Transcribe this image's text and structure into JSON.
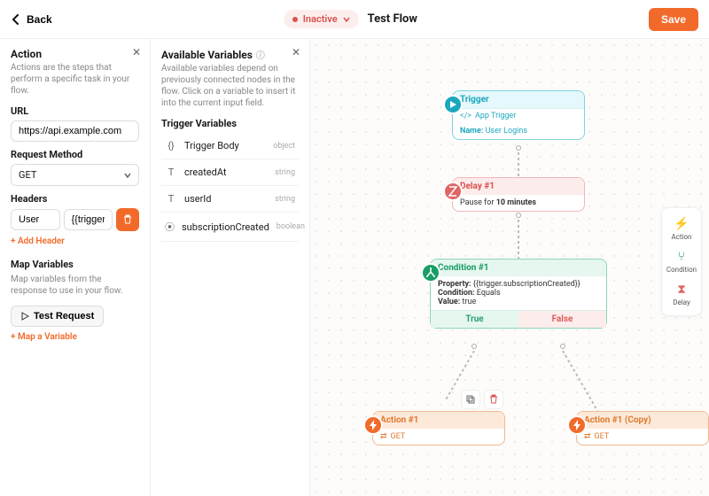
{
  "header": {
    "back_label": "Back",
    "status_label": "Inactive",
    "flow_title": "Test Flow",
    "save_label": "Save"
  },
  "action_panel": {
    "title": "Action",
    "subtitle": "Actions are the steps that perform a specific task in your flow.",
    "url_label": "URL",
    "url_value": "https://api.example.com",
    "method_label": "Request Method",
    "method_value": "GET",
    "headers_label": "Headers",
    "header_key": "User",
    "header_value": "{{trigger.userId}}",
    "add_header": "+ Add Header",
    "map_title": "Map Variables",
    "map_subtitle": "Map variables from the response to use in your flow.",
    "test_request": "Test Request",
    "map_variable": "+ Map a Variable"
  },
  "variables_panel": {
    "title": "Available Variables",
    "subtitle": "Available variables depend on previously connected nodes in the flow. Click on a variable to insert it into the current input field.",
    "group_label": "Trigger Variables",
    "items": [
      {
        "icon": "{}",
        "name": "Trigger Body",
        "kind": "object"
      },
      {
        "icon": "T",
        "name": "createdAt",
        "kind": "string"
      },
      {
        "icon": "T",
        "name": "userId",
        "kind": "string"
      },
      {
        "icon": "⦿",
        "name": "subscriptionCreated",
        "kind": "boolean"
      }
    ]
  },
  "nodes": {
    "trigger": {
      "title": "Trigger",
      "subtitle": "App Trigger",
      "name_label": "Name:",
      "name_value": "User Logins"
    },
    "delay": {
      "title": "Delay #1",
      "pause_prefix": "Pause for ",
      "pause_value": "10 minutes"
    },
    "condition": {
      "title": "Condition #1",
      "property_label": "Property:",
      "property_value": "{{trigger.subscriptionCreated}}",
      "condition_label": "Condition:",
      "condition_value": "Equals",
      "value_label": "Value:",
      "value_value": "true",
      "true_label": "True",
      "false_label": "False"
    },
    "action1": {
      "title": "Action #1",
      "method": "GET"
    },
    "action1copy": {
      "title": "Action #1 (Copy)",
      "method": "GET"
    }
  },
  "palette": {
    "action": "Action",
    "condition": "Condition",
    "delay": "Delay"
  }
}
